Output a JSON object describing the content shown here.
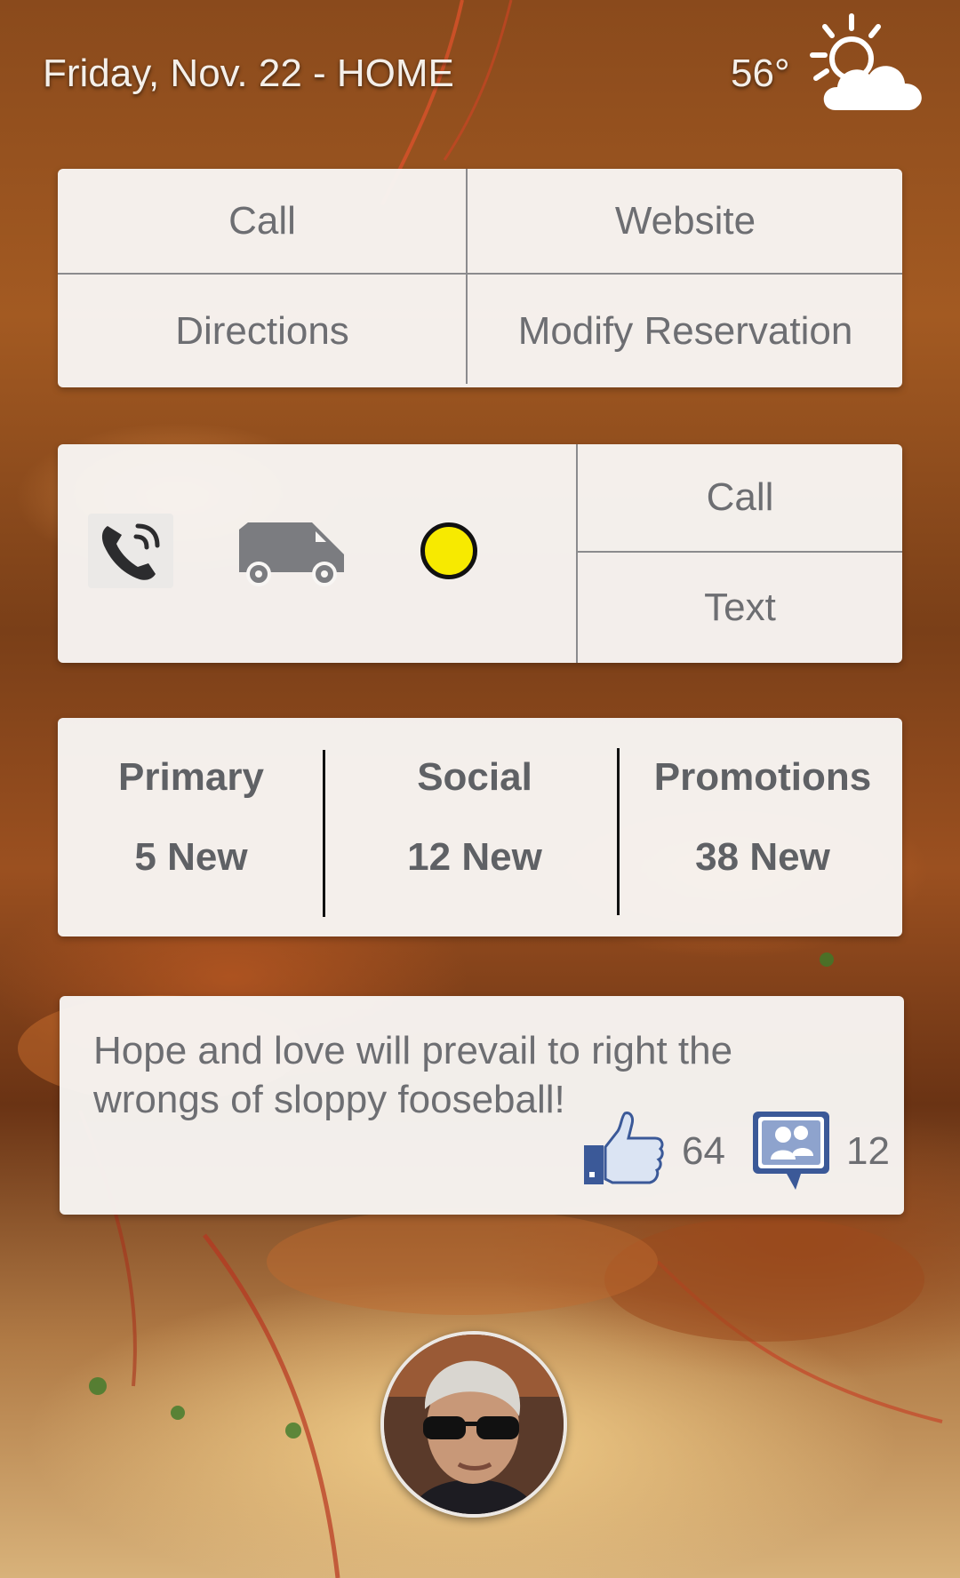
{
  "header": {
    "date_text": "Friday, Nov. 22 - HOME",
    "temperature": "56°",
    "weather_icon": "sun-cloud-icon"
  },
  "actions": {
    "call": "Call",
    "website": "Website",
    "directions": "Directions",
    "modify_reservation": "Modify Reservation"
  },
  "contact": {
    "icons": [
      "phone-icon",
      "delivery-van-icon",
      "status-dot-icon"
    ],
    "status_color": "#f7ea00",
    "call": "Call",
    "text": "Text"
  },
  "mail": {
    "categories": [
      {
        "label": "Primary",
        "count": "5 New"
      },
      {
        "label": "Social",
        "count": "12 New"
      },
      {
        "label": "Promotions",
        "count": "38 New"
      }
    ]
  },
  "post": {
    "text": "Hope and love will prevail to right the wrongs of sloppy fooseball!",
    "likes": "64",
    "comments": "12",
    "like_icon": "thumbs-up-icon",
    "comment_icon": "group-chat-icon"
  },
  "profile": {
    "avatar": "user-avatar"
  }
}
